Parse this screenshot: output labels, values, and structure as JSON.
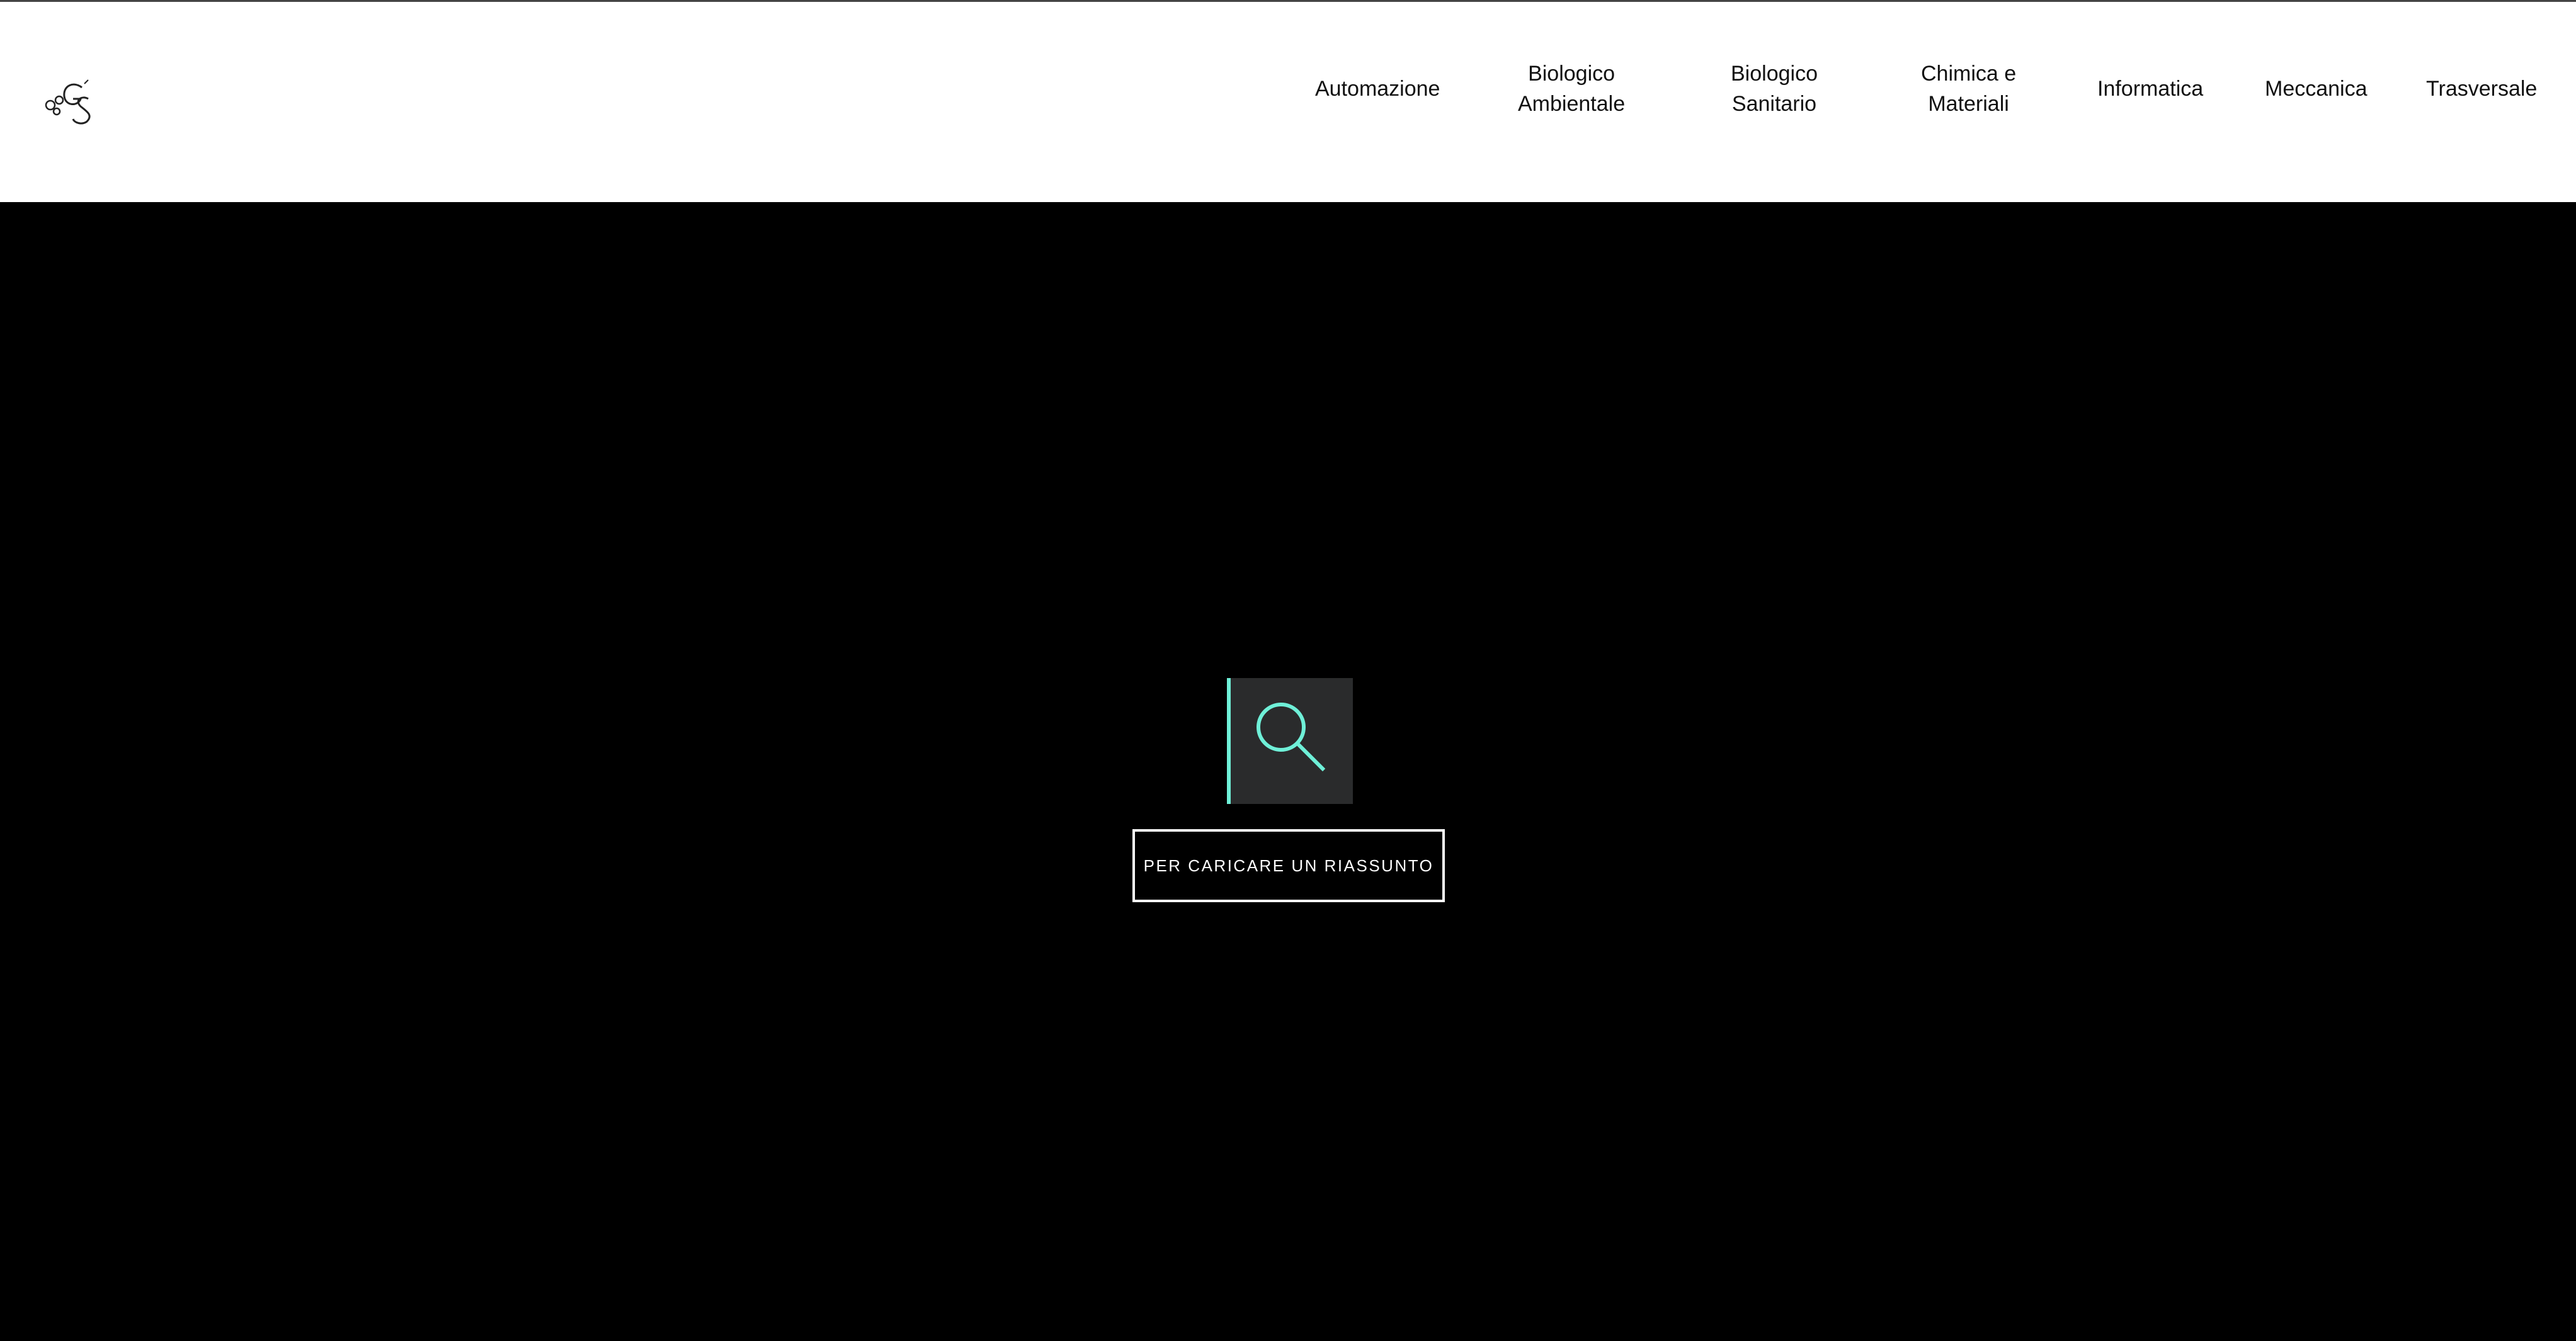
{
  "header": {
    "logo": {
      "icon": "gs-monogram-logo"
    },
    "nav": [
      {
        "id": "automazione",
        "lines": [
          "Automazione"
        ]
      },
      {
        "id": "biologico-ambientale",
        "lines": [
          "Biologico",
          "Ambientale"
        ]
      },
      {
        "id": "biologico-sanitario",
        "lines": [
          "Biologico",
          "Sanitario"
        ]
      },
      {
        "id": "chimica-materiali",
        "lines": [
          "Chimica e",
          "Materiali"
        ]
      },
      {
        "id": "informatica",
        "lines": [
          "Informatica"
        ]
      },
      {
        "id": "meccanica",
        "lines": [
          "Meccanica"
        ]
      },
      {
        "id": "trasversale",
        "lines": [
          "Trasversale"
        ]
      }
    ]
  },
  "hero": {
    "search": {
      "icon": "search-icon",
      "accent_color": "#6ff0d8",
      "box_color": "#2a2b2c"
    },
    "upload_button_label": "PER CARICARE UN RIASSUNTO"
  },
  "colors": {
    "header_bg": "#ffffff",
    "hero_bg": "#000000",
    "nav_text": "#111111"
  }
}
